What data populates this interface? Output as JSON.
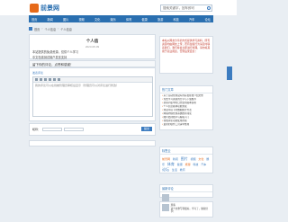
{
  "header": {
    "logo_text": "前景网",
    "search_placeholder": "搜索关键字，回车即可"
  },
  "nav": {
    "items": [
      "首页",
      "新闻",
      "图片",
      "视频",
      "文化",
      "娱乐",
      "体育",
      "健康",
      "旅游",
      "科技",
      "汽车",
      "论坛"
    ]
  },
  "breadcrumb": {
    "items": [
      "首页",
      "个人信息",
      "个人信息"
    ]
  },
  "article": {
    "title": "个人信",
    "meta": "2023-08-09",
    "lines": [
      "本站提供的免费资源，仅供个人学习",
      "中文在线测试用户发言支持"
    ]
  },
  "comment": {
    "heading": "留下你的评论，点赞和感谢！",
    "label": "发表评论",
    "hint": "我的评论可以在线被管理员审核后显示（管理员可以对评论进行修改）",
    "name_label": "昵称：",
    "submit_label": "提交"
  },
  "notice": {
    "text": "本站以网友分享的方式提供学习资料，所有资源均由网友上传；若有侵权行为请及时联系我们，我们将会立即进行处理。请勿将其用于商业用途，否则后果自负！"
  },
  "panels": {
    "hot_title": "热门文章",
    "hot_items": [
      "关于自动化测试库的好处在线介绍文章",
      "免费学习资源的分享与下载推荐",
      "新闻列表中的日志更新版本说明",
      "个人信息模块功能测试",
      "测试环境下的数据统计方法",
      "网站内容管理系统推荐阅读",
      "图片处理技术与编辑入门",
      "在线评论功能使用帮助",
      "最新的软件工具清单整理"
    ],
    "tags_title": "标签云",
    "tags": [
      "前景网",
      "新闻",
      "图片",
      "视频",
      "文化",
      "娱乐",
      "体育",
      "健康",
      "旅游",
      "科技",
      "汽车",
      "论坛",
      "生活",
      "教育"
    ],
    "user_title": "最新评论",
    "user_name": "游客",
    "user_comment": "这个文章写得很好，学习了，谢谢分享！"
  },
  "colors": {
    "brand": "#2a6fb0",
    "accent": "#e66a1a"
  }
}
